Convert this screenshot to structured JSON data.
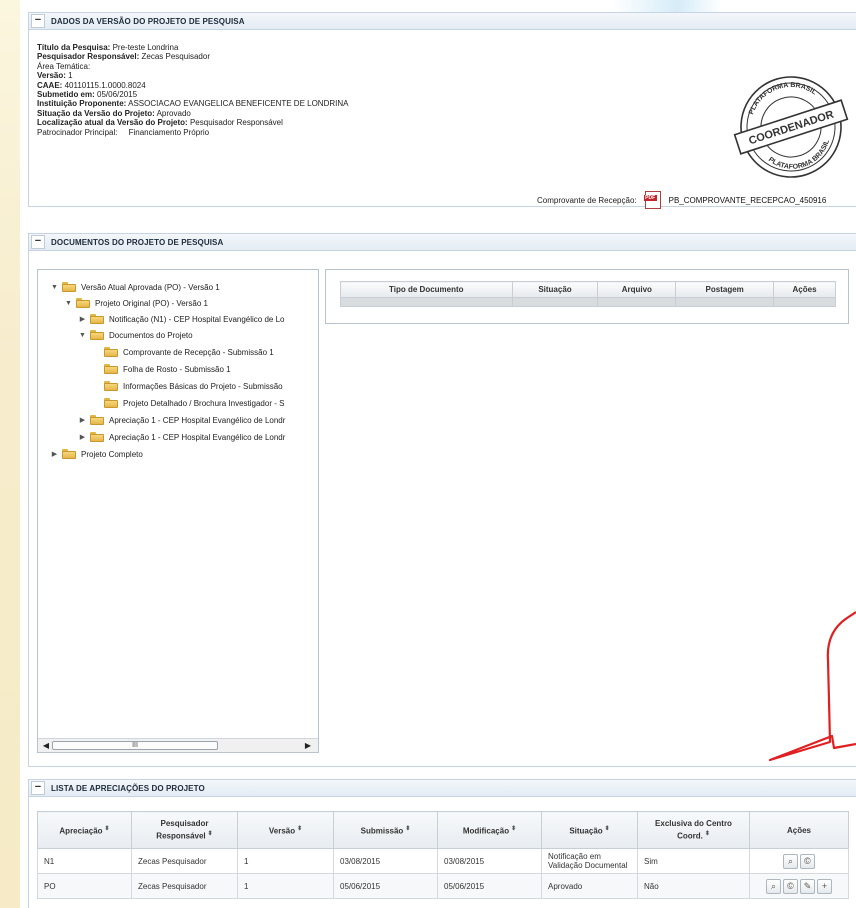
{
  "panel_info": {
    "title": "DADOS DA VERSÃO DO PROJETO DE PESQUISA",
    "toggle": "−",
    "fields": {
      "titulo_label": "Título da Pesquisa:",
      "titulo_value": "Pre-teste Londrina",
      "pesquisador_label": "Pesquisador Responsável:",
      "pesquisador_value": "Zecas Pesquisador",
      "area_label": "Área Temática:",
      "versao_label": "Versão:",
      "versao_value": "1",
      "caae_label": "CAAE:",
      "caae_value": "40110115.1.0000.8024",
      "submetido_label": "Submetido em:",
      "submetido_value": "05/06/2015",
      "instituicao_label": "Instituição Proponente:",
      "instituicao_value": "ASSOCIACAO EVANGELICA BENEFICENTE DE LONDRINA",
      "situacao_label": "Situação da Versão do Projeto:",
      "situacao_value": "Aprovado",
      "localizacao_label": "Localização atual da Versão do Projeto:",
      "localizacao_value": "Pesquisador Responsável",
      "patrocinador_label": "Patrocinador Principal:",
      "patrocinador_value": "Financiamento Próprio"
    },
    "stamp": {
      "top_text": "PLATAFORMA BRASIL",
      "center_text": "COORDENADOR",
      "bottom_text": "PLATAFORMA BRASIL"
    },
    "receipt_label": "Comprovante de Recepção:",
    "receipt_icon_text": "PDF",
    "receipt_file": "PB_COMPROVANTE_RECEPCAO_450916"
  },
  "panel_docs": {
    "title": "DOCUMENTOS DO PROJETO DE PESQUISA",
    "toggle": "−",
    "tree": [
      {
        "label": "Versão Atual Aprovada (PO) - Versão 1",
        "expanded": true
      },
      {
        "label": "Projeto Original (PO) - Versão 1",
        "expanded": true
      },
      {
        "label": "Notificação (N1) - CEP Hospital Evangélico de Lo",
        "expanded": false
      },
      {
        "label": "Documentos do Projeto",
        "expanded": true
      },
      {
        "label": "Comprovante de Recepção - Submissão 1"
      },
      {
        "label": "Folha de Rosto - Submissão 1"
      },
      {
        "label": "Informações Básicas do Projeto - Submissão"
      },
      {
        "label": "Projeto Detalhado / Brochura Investigador - S"
      },
      {
        "label": "Apreciação 1 - CEP Hospital Evangélico de Londr",
        "expanded": false
      },
      {
        "label": "Apreciação 1 - CEP Hospital Evangélico de Londr",
        "expanded": false
      },
      {
        "label": "Projeto Completo",
        "expanded": false
      }
    ],
    "scroll_thumb": "III",
    "scroll_left": "◀",
    "scroll_right": "▶",
    "table_headers": [
      "Tipo de Documento",
      "Situação",
      "Arquivo",
      "Postagem",
      "Ações"
    ]
  },
  "panel_apreciacoes": {
    "title": "LISTA DE APRECIAÇÕES DO PROJETO",
    "toggle": "−",
    "headers": {
      "apreciacao": "Apreciação",
      "pesquisador": "Pesquisador Responsável",
      "versao": "Versão",
      "submissao": "Submissão",
      "modificacao": "Modificação",
      "situacao": "Situação",
      "exclusiva": "Exclusiva do Centro Coord.",
      "acoes": "Ações",
      "sort_mark": "⬍"
    },
    "rows": [
      {
        "apreciacao": "N1",
        "pesquisador": "Zecas Pesquisador",
        "versao": "1",
        "submissao": "03/08/2015",
        "modificacao": "03/08/2015",
        "situacao": "Notificação em Validação Documental",
        "exclusiva": "Sim"
      },
      {
        "apreciacao": "PO",
        "pesquisador": "Zecas Pesquisador",
        "versao": "1",
        "submissao": "05/06/2015",
        "modificacao": "05/06/2015",
        "situacao": "Aprovado",
        "exclusiva": "Não"
      }
    ]
  },
  "colors": {
    "callout": "#e02020",
    "panel_border": "#c5d3e2",
    "stamp": "#333333"
  }
}
